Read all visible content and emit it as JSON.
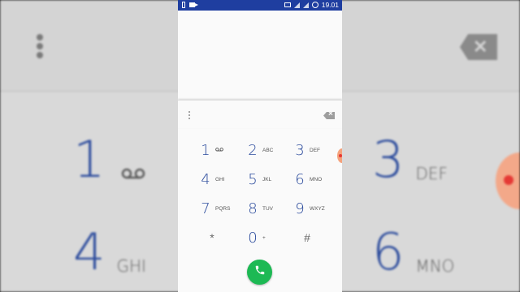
{
  "status_bar": {
    "time": "19.01"
  },
  "keypad": [
    {
      "digit": "1",
      "letters": "",
      "voicemail": true
    },
    {
      "digit": "2",
      "letters": "ABC"
    },
    {
      "digit": "3",
      "letters": "DEF"
    },
    {
      "digit": "4",
      "letters": "GHI"
    },
    {
      "digit": "5",
      "letters": "JKL"
    },
    {
      "digit": "6",
      "letters": "MNO"
    },
    {
      "digit": "7",
      "letters": "PQRS"
    },
    {
      "digit": "8",
      "letters": "TUV"
    },
    {
      "digit": "9",
      "letters": "WXYZ"
    },
    {
      "digit": "*",
      "letters": ""
    },
    {
      "digit": "0",
      "letters": "+"
    },
    {
      "digit": "#",
      "letters": ""
    }
  ],
  "background": {
    "keys": [
      {
        "digit": "1",
        "letters": ""
      },
      {
        "digit": "3",
        "letters": "DEF"
      },
      {
        "digit": "4",
        "letters": "GHI"
      },
      {
        "digit": "6",
        "letters": "MNO"
      }
    ]
  },
  "icons": {
    "menu": "more-vert-icon",
    "backspace": "backspace-icon",
    "call": "phone-icon",
    "voicemail": "voicemail-icon"
  },
  "colors": {
    "status_bar": "#1f3ea0",
    "digit": "#2a4a9c",
    "call": "#1db954"
  }
}
